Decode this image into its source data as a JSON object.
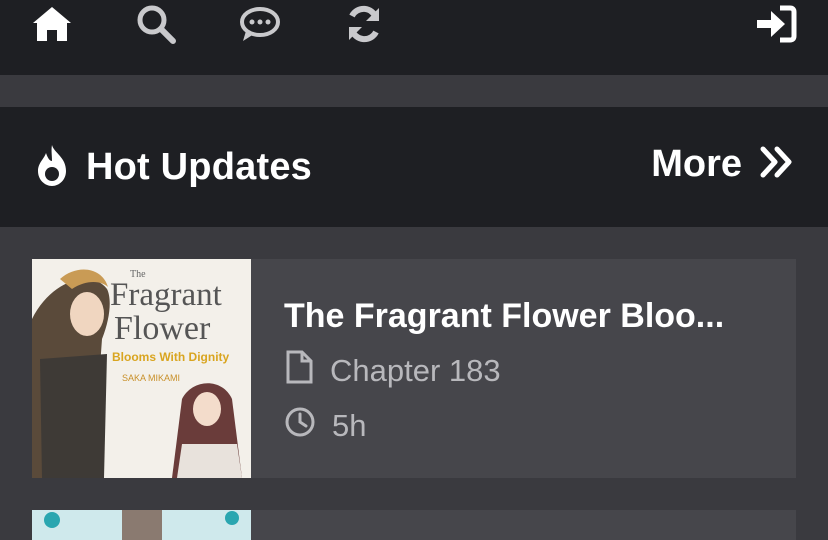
{
  "nav": {
    "icons": [
      "home-icon",
      "search-icon",
      "chat-icon",
      "refresh-icon",
      "sign-in-icon"
    ]
  },
  "section": {
    "title": "Hot Updates",
    "icon": "fire-icon",
    "more_label": "More",
    "more_icon": "double-chevron-right-icon"
  },
  "updates": [
    {
      "title": "The Fragrant Flower Bloo...",
      "chapter": "Chapter 183",
      "time": "5h",
      "cover_text": {
        "top": "The",
        "line1": "Fragrant",
        "line2": "Flower",
        "line3": "Blooms With Dignity",
        "author": "SAKA MIKAMI"
      }
    }
  ],
  "colors": {
    "nav_bg": "#1e1f23",
    "page_bg": "#3a3a3f",
    "card_bg": "#46464b",
    "muted_text": "#b8b8bc",
    "accent_gold": "#d9a520"
  }
}
